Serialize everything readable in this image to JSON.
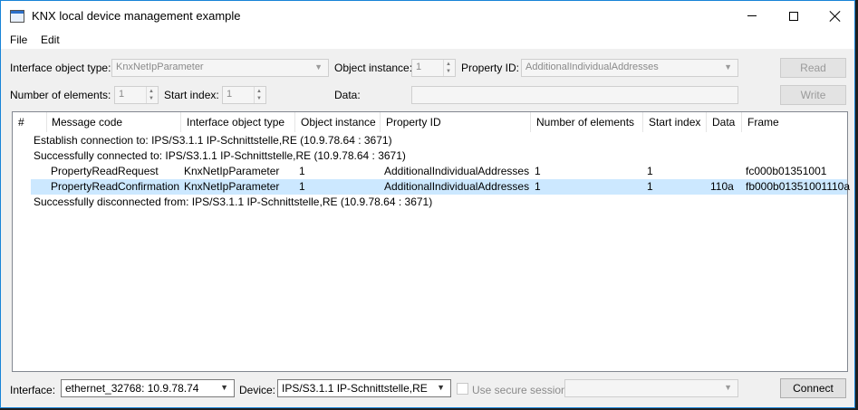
{
  "window": {
    "title": "KNX local device management example"
  },
  "menu": {
    "file": "File",
    "edit": "Edit"
  },
  "form": {
    "interface_object_type_label": "Interface object type:",
    "interface_object_type_value": "KnxNetIpParameter",
    "object_instance_label": "Object instance:",
    "object_instance_value": "1",
    "property_id_label": "Property ID:",
    "property_id_value": "AdditionalIndividualAddresses",
    "read_button": "Read",
    "number_of_elements_label": "Number of elements:",
    "number_of_elements_value": "1",
    "start_index_label": "Start index:",
    "start_index_value": "1",
    "data_label": "Data:",
    "write_button": "Write"
  },
  "table": {
    "columns": [
      "#",
      "Message code",
      "Interface object type",
      "Object instance",
      "Property ID",
      "Number of elements",
      "Start index",
      "Data",
      "Frame"
    ],
    "rows": [
      {
        "info": "Establish connection to: IPS/S3.1.1 IP-Schnittstelle,RE (10.9.78.64 : 3671)"
      },
      {
        "info": "Successfully connected to: IPS/S3.1.1 IP-Schnittstelle,RE (10.9.78.64 : 3671)"
      },
      {
        "message_code": "PropertyReadRequest",
        "interface_object_type": "KnxNetIpParameter",
        "object_instance": "1",
        "property_id": "AdditionalIndividualAddresses",
        "number_of_elements": "1",
        "start_index": "1",
        "data": "",
        "frame": "fc000b01351001"
      },
      {
        "message_code": "PropertyReadConfirmation",
        "interface_object_type": "KnxNetIpParameter",
        "object_instance": "1",
        "property_id": "AdditionalIndividualAddresses",
        "number_of_elements": "1",
        "start_index": "1",
        "data": "110a",
        "frame": "fb000b01351001110a"
      },
      {
        "info": "Successfully disconnected from: IPS/S3.1.1 IP-Schnittstelle,RE (10.9.78.64 : 3671)"
      }
    ]
  },
  "bottom": {
    "interface_label": "Interface:",
    "interface_value": "ethernet_32768: 10.9.78.74",
    "device_label": "Device:",
    "device_value": "IPS/S3.1.1 IP-Schnittstelle,RE",
    "secure_session_label": "Use secure session",
    "connect_button": "Connect"
  }
}
